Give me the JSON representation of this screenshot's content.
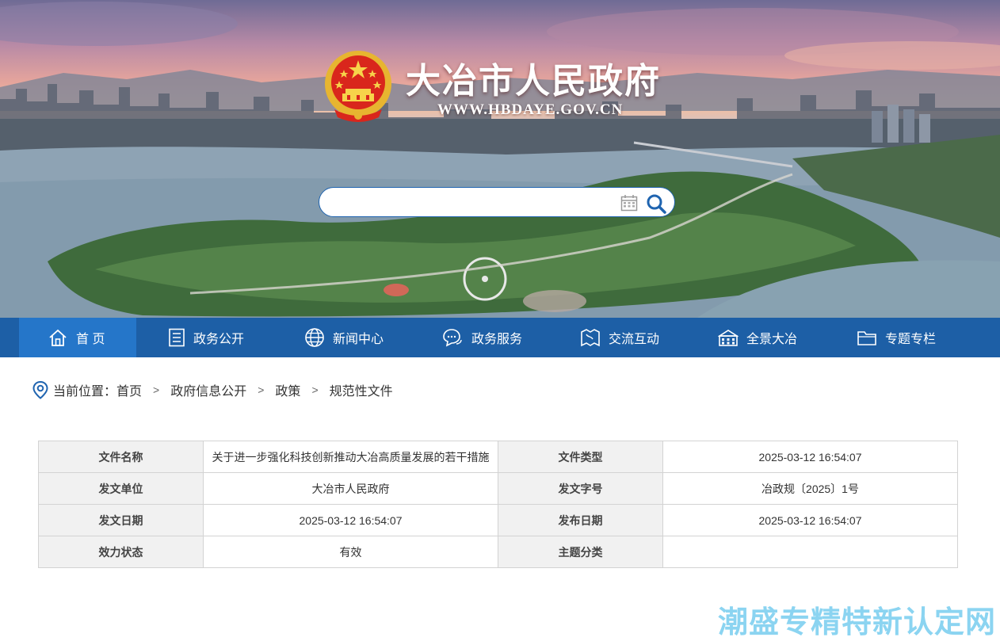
{
  "header": {
    "site_title": "大冶市人民政府",
    "site_url": "WWW.HBDAYE.GOV.CN",
    "search": {
      "placeholder": "",
      "value": ""
    }
  },
  "nav": {
    "items": [
      {
        "label": "首 页",
        "icon": "home-icon",
        "active": true
      },
      {
        "label": "政务公开",
        "icon": "document-list-icon"
      },
      {
        "label": "新闻中心",
        "icon": "globe-icon"
      },
      {
        "label": "政务服务",
        "icon": "chat-bubbles-icon"
      },
      {
        "label": "交流互动",
        "icon": "map-icon"
      },
      {
        "label": "全景大冶",
        "icon": "panorama-icon"
      },
      {
        "label": "专题专栏",
        "icon": "folder-icon"
      }
    ]
  },
  "breadcrumb": {
    "prefix": "当前位置：",
    "items": [
      "首页",
      "政府信息公开",
      "政策",
      "规范性文件"
    ]
  },
  "document_meta": {
    "rows": [
      [
        {
          "k": "文件名称",
          "v": "关于进一步强化科技创新推动大冶高质量发展的若干措施"
        },
        {
          "k": "文件类型",
          "v": "2025-03-12 16:54:07"
        }
      ],
      [
        {
          "k": "发文单位",
          "v": "大冶市人民政府"
        },
        {
          "k": "发文字号",
          "v": "冶政规〔2025〕1号"
        }
      ],
      [
        {
          "k": "发文日期",
          "v": "2025-03-12 16:54:07"
        },
        {
          "k": "发布日期",
          "v": "2025-03-12 16:54:07"
        }
      ],
      [
        {
          "k": "效力状态",
          "v": "有效"
        },
        {
          "k": "主题分类",
          "v": ""
        }
      ]
    ]
  },
  "watermark": "潮盛专精特新认定网",
  "colors": {
    "nav_bg": "#1d5fa6",
    "nav_active": "#2576c9",
    "key_cell_bg": "#f1f1f1",
    "border": "#d3d3d3"
  }
}
